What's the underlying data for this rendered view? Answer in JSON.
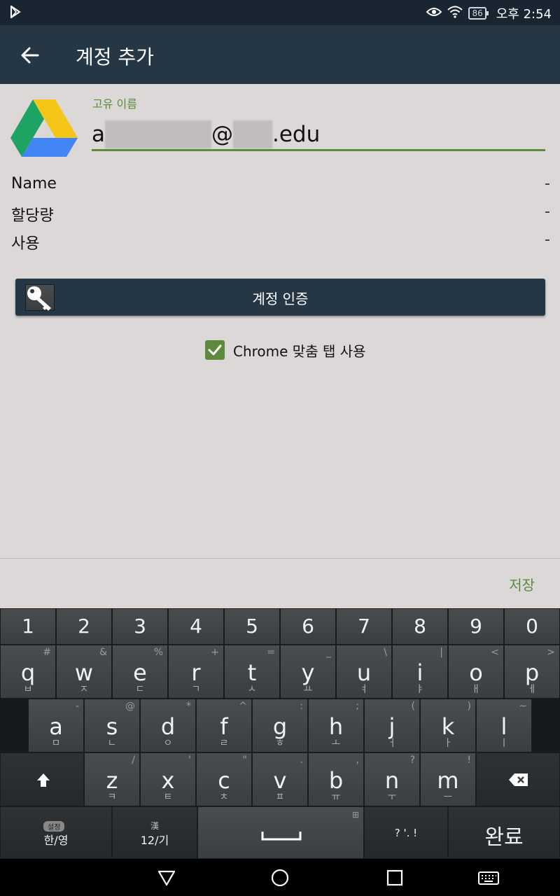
{
  "status_bar": {
    "time": "오후 2:54",
    "battery": "86"
  },
  "app_bar": {
    "title": "계정 추가"
  },
  "form": {
    "field_label": "고유 이름",
    "email_prefix": "a",
    "email_at": "@",
    "email_suffix": ".edu"
  },
  "info_rows": [
    {
      "label": "Name",
      "value": "-"
    },
    {
      "label": "할당량",
      "value": "-"
    },
    {
      "label": "사용",
      "value": "-"
    }
  ],
  "auth_button": {
    "label": "계정 인증"
  },
  "checkbox": {
    "label": "Chrome 맞춤 탭 사용",
    "checked": true
  },
  "save_button": {
    "label": "저장"
  },
  "keyboard": {
    "numbers": [
      "1",
      "2",
      "3",
      "4",
      "5",
      "6",
      "7",
      "8",
      "9",
      "0"
    ],
    "row1": [
      {
        "main": "q",
        "sub": "#",
        "han": "ㅂ"
      },
      {
        "main": "w",
        "sub": "&",
        "han": "ㅈ"
      },
      {
        "main": "e",
        "sub": "%",
        "han": "ㄷ"
      },
      {
        "main": "r",
        "sub": "+",
        "han": "ㄱ"
      },
      {
        "main": "t",
        "sub": "=",
        "han": "ㅅ"
      },
      {
        "main": "y",
        "sub": "_",
        "han": "ㅛ"
      },
      {
        "main": "u",
        "sub": "\\",
        "han": "ㅕ"
      },
      {
        "main": "i",
        "sub": "|",
        "han": "ㅑ"
      },
      {
        "main": "o",
        "sub": "<",
        "han": "ㅐ"
      },
      {
        "main": "p",
        "sub": ">",
        "han": "ㅔ"
      }
    ],
    "row2": [
      {
        "main": "a",
        "sub": "-",
        "han": "ㅁ"
      },
      {
        "main": "s",
        "sub": "@",
        "han": "ㄴ"
      },
      {
        "main": "d",
        "sub": "*",
        "han": "ㅇ"
      },
      {
        "main": "f",
        "sub": "^",
        "han": "ㄹ"
      },
      {
        "main": "g",
        "sub": ":",
        "han": "ㅎ"
      },
      {
        "main": "h",
        "sub": ";",
        "han": "ㅗ"
      },
      {
        "main": "j",
        "sub": "(",
        "han": "ㅓ"
      },
      {
        "main": "k",
        "sub": ")",
        "han": "ㅏ"
      },
      {
        "main": "l",
        "sub": "~",
        "han": "ㅣ"
      }
    ],
    "row3": [
      {
        "main": "z",
        "sub": "/",
        "han": "ㅋ"
      },
      {
        "main": "x",
        "sub": "'",
        "han": "ㅌ"
      },
      {
        "main": "c",
        "sub": "\"",
        "han": "ㅊ"
      },
      {
        "main": "v",
        "sub": ".",
        "han": "ㅍ"
      },
      {
        "main": "b",
        "sub": ",",
        "han": "ㅠ"
      },
      {
        "main": "n",
        "sub": "?",
        "han": "ㅜ"
      },
      {
        "main": "m",
        "sub": "!",
        "han": "ㅡ"
      }
    ],
    "lang_small": "설정",
    "lang_label": "한/영",
    "sym_small": "漢",
    "sym_label": "12/기",
    "punct_label": "?  '.  !",
    "done_label": "완료"
  }
}
